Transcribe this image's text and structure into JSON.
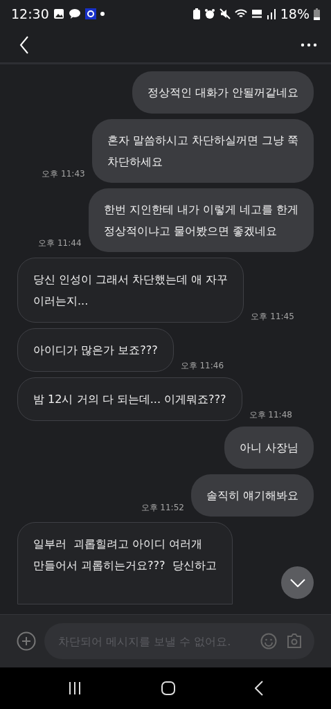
{
  "status_bar": {
    "time": "12:30",
    "battery": "18%"
  },
  "messages": [
    {
      "kind": "sent",
      "text": "정상적인 대화가 안될꺼같네요"
    },
    {
      "kind": "sent",
      "text": "혼자 말씀하시고 차단하실꺼면 그냥 쭉\n차단하세요",
      "time": "오후 11:43"
    },
    {
      "kind": "sent",
      "text": "한번 지인한테 내가 이렇게 네고를 한게\n정상적이냐고 물어봤으면 좋겠네요",
      "time": "오후 11:44"
    },
    {
      "kind": "received",
      "text": "당신 인성이 그래서 차단했는데 애 자꾸\n이러는지...",
      "time": "오후 11:45"
    },
    {
      "kind": "received",
      "text": "아이디가 많은가 보죠???",
      "time": "오후 11:46"
    },
    {
      "kind": "received",
      "text": "밤 12시 거의 다 되는데... 이게뭐죠???",
      "time": "오후 11:48"
    },
    {
      "kind": "sent",
      "text": "아니 사장님"
    },
    {
      "kind": "sent",
      "text": "솔직히 얘기해봐요",
      "time": "오후 11:52"
    },
    {
      "kind": "received",
      "text": "일부러  괴롭힐려고 아이디 여러개\n만들어서 괴롭히는거요???  당신하고"
    }
  ],
  "input": {
    "placeholder": "차단되어 메시지를 보낼 수 없어요.",
    "disabled": true
  }
}
